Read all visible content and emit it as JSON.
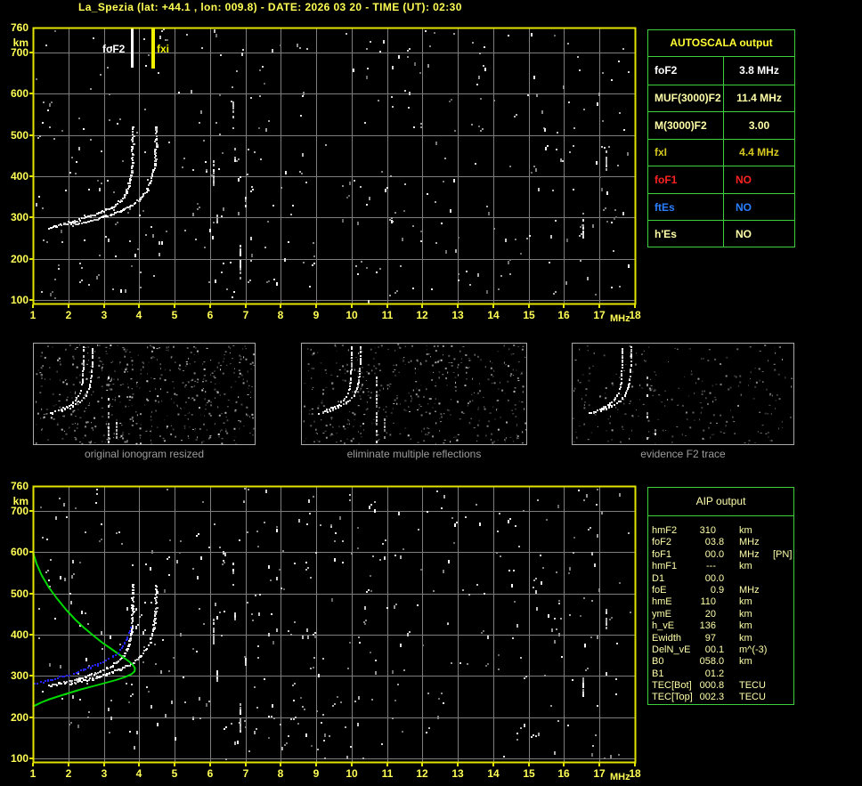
{
  "title": {
    "text": "La_Spezia (lat: +44.1 , lon: 009.8) - DATE: 2026 03 20 - TIME (UT): 02:30"
  },
  "colors": {
    "background": "#000000",
    "frame": "#e3e300",
    "grid": "#7d7d7d",
    "tick_label": "#ffff55",
    "title": "#ffff55",
    "table_border": "#3ecf3e",
    "caption": "#9c9c9c",
    "thumb_border": "#aaaaaa",
    "trace_white": "#ffffff",
    "profile_green": "#00d800",
    "restored_blue": "#2424ff",
    "marker_foF2": "#ffffff",
    "marker_fxi": "#f2f200"
  },
  "axis": {
    "x_labels": [
      "1",
      "2",
      "3",
      "4",
      "5",
      "6",
      "7",
      "8",
      "9",
      "10",
      "11",
      "12",
      "13",
      "14",
      "15",
      "16",
      "17",
      "18"
    ],
    "y_labels": [
      "760",
      "700",
      "600",
      "500",
      "400",
      "300",
      "200",
      "100"
    ],
    "x_unit": "MHz",
    "y_unit": "km"
  },
  "markers": {
    "foF2_label": "foF2",
    "fxi_label": "fxi",
    "foF2_mhz": 3.8,
    "fxi_mhz": 4.4
  },
  "autoscala": {
    "header": "AUTOSCALA output",
    "rows": [
      {
        "label": "foF2",
        "value": "3.8 MHz",
        "color": "#ffffff"
      },
      {
        "label": "MUF(3000)F2",
        "value": "11.4 MHz",
        "color": "#ffffa8"
      },
      {
        "label": "M(3000)F2",
        "value": "3.00",
        "color": "#ffffa8"
      },
      {
        "label": "fxI",
        "value": "4.4 MHz",
        "color": "#d6c81e"
      },
      {
        "label": "foF1",
        "value": "NO",
        "color": "#ff2222"
      },
      {
        "label": "ftEs",
        "value": "NO",
        "color": "#2b7fff"
      },
      {
        "label": "h'Es",
        "value": "NO",
        "color": "#ffffa8"
      }
    ]
  },
  "aip": {
    "header": "AIP output",
    "rows": [
      {
        "label": "hmF2",
        "vi": "310",
        "vf": "",
        "unit": "km",
        "extra": ""
      },
      {
        "label": "foF2",
        "vi": "03",
        "vf": ".8",
        "unit": "MHz",
        "extra": ""
      },
      {
        "label": "foF1",
        "vi": "00",
        "vf": ".0",
        "unit": "MHz",
        "extra": "[PN]"
      },
      {
        "label": "hmF1",
        "vi": "---",
        "vf": "",
        "unit": "km",
        "extra": ""
      },
      {
        "label": "D1",
        "vi": "00",
        "vf": ".0",
        "unit": "",
        "extra": ""
      },
      {
        "label": "foE",
        "vi": "0",
        "vf": ".9",
        "unit": "MHz",
        "extra": ""
      },
      {
        "label": "hmE",
        "vi": "110",
        "vf": "",
        "unit": "km",
        "extra": ""
      },
      {
        "label": "ymE",
        "vi": "20",
        "vf": "",
        "unit": "km",
        "extra": ""
      },
      {
        "label": "h_vE",
        "vi": "136",
        "vf": "",
        "unit": "km",
        "extra": ""
      },
      {
        "label": "Ewidth",
        "vi": "97",
        "vf": "",
        "unit": "km",
        "extra": ""
      },
      {
        "label": "DelN_vE",
        "vi": "00",
        "vf": ".1",
        "unit": "m^(-3)",
        "extra": ""
      },
      {
        "label": "B0",
        "vi": "058",
        "vf": ".0",
        "unit": "km",
        "extra": ""
      },
      {
        "label": "B1",
        "vi": "01",
        "vf": ".2",
        "unit": "",
        "extra": ""
      },
      {
        "label": "TEC[Bot]",
        "vi": "000",
        "vf": ".8",
        "unit": "TECU",
        "extra": ""
      },
      {
        "label": "TEC[Top]",
        "vi": "002",
        "vf": ".3",
        "unit": "TECU",
        "extra": ""
      }
    ]
  },
  "thumbnails": [
    {
      "caption": "original ionogram resized",
      "noise": 540,
      "bright": 215
    },
    {
      "caption": "eliminate multiple reflections",
      "noise": 460,
      "bright": 205
    },
    {
      "caption": "evidence F2 trace",
      "noise": 250,
      "bright": 165
    }
  ],
  "chart_data": [
    {
      "id": "main-ionogram",
      "type": "scatter",
      "title": "scaled ionogram with foF2 and fxI markers",
      "xlabel": "MHz",
      "ylabel": "km",
      "xlim": [
        1,
        18
      ],
      "ylim": [
        100,
        760
      ],
      "grid": true,
      "markers": [
        {
          "name": "foF2",
          "freq_mhz": 3.8,
          "color": "#ffffff"
        },
        {
          "name": "fxi",
          "freq_mhz": 4.4,
          "color": "#f2f200"
        }
      ],
      "series": [
        {
          "name": "O-trace",
          "color": "#ffffff",
          "points": [
            [
              1.42,
              277
            ],
            [
              1.55,
              280
            ],
            [
              1.7,
              283
            ],
            [
              1.85,
              286
            ],
            [
              2.0,
              289
            ],
            [
              2.15,
              292
            ],
            [
              2.3,
              296
            ],
            [
              2.45,
              300
            ],
            [
              2.6,
              304
            ],
            [
              2.75,
              308
            ],
            [
              2.9,
              313
            ],
            [
              3.05,
              319
            ],
            [
              3.2,
              326
            ],
            [
              3.32,
              333
            ],
            [
              3.44,
              342
            ],
            [
              3.54,
              352
            ],
            [
              3.62,
              364
            ],
            [
              3.68,
              377
            ],
            [
              3.72,
              391
            ],
            [
              3.75,
              406
            ],
            [
              3.77,
              424
            ],
            [
              3.785,
              444
            ],
            [
              3.79,
              466
            ],
            [
              3.795,
              490
            ],
            [
              3.8,
              515
            ],
            [
              3.8,
              523
            ]
          ]
        },
        {
          "name": "X-trace",
          "color": "#ffffff",
          "points": [
            [
              2.05,
              283
            ],
            [
              2.25,
              287
            ],
            [
              2.45,
              291
            ],
            [
              2.65,
              295
            ],
            [
              2.85,
              300
            ],
            [
              3.05,
              305
            ],
            [
              3.25,
              311
            ],
            [
              3.45,
              318
            ],
            [
              3.65,
              326
            ],
            [
              3.83,
              335
            ],
            [
              3.98,
              345
            ],
            [
              4.1,
              356
            ],
            [
              4.2,
              369
            ],
            [
              4.28,
              384
            ],
            [
              4.34,
              400
            ],
            [
              4.39,
              418
            ],
            [
              4.42,
              438
            ],
            [
              4.44,
              460
            ],
            [
              4.45,
              484
            ],
            [
              4.455,
              508
            ],
            [
              4.46,
              522
            ]
          ]
        }
      ],
      "noise_streaks": [
        [
          6.66,
          546,
          584
        ],
        [
          6.72,
          440,
          478
        ],
        [
          6.2,
          292,
          318
        ],
        [
          6.86,
          156,
          236
        ],
        [
          7.0,
          330,
          352
        ],
        [
          6.1,
          382,
          440
        ],
        [
          16.55,
          255,
          300
        ],
        [
          17.2,
          420,
          465
        ]
      ],
      "noise_density": 380
    },
    {
      "id": "aip-ionogram",
      "type": "scatter",
      "title": "ionogram with AIP electron density profile and restored F2 trace",
      "xlabel": "MHz",
      "ylabel": "km",
      "xlim": [
        1,
        18
      ],
      "ylim": [
        100,
        760
      ],
      "grid": true,
      "series_from": "main-ionogram",
      "profile": {
        "name": "electron-density-profile",
        "color": "#00d800",
        "points": [
          [
            1.0,
            600
          ],
          [
            1.1,
            572
          ],
          [
            1.25,
            543
          ],
          [
            1.45,
            514
          ],
          [
            1.7,
            485
          ],
          [
            1.95,
            459
          ],
          [
            2.2,
            436
          ],
          [
            2.45,
            416
          ],
          [
            2.7,
            398
          ],
          [
            2.95,
            381
          ],
          [
            3.2,
            366
          ],
          [
            3.45,
            351
          ],
          [
            3.65,
            339
          ],
          [
            3.8,
            329
          ],
          [
            3.88,
            319
          ],
          [
            3.87,
            311
          ],
          [
            3.78,
            304
          ],
          [
            3.6,
            297
          ],
          [
            3.35,
            290
          ],
          [
            3.05,
            283
          ],
          [
            2.7,
            275
          ],
          [
            2.35,
            267
          ],
          [
            2.0,
            258
          ],
          [
            1.7,
            250
          ],
          [
            1.45,
            243
          ],
          [
            1.25,
            236
          ],
          [
            1.1,
            230
          ],
          [
            1.0,
            226
          ]
        ]
      },
      "restored_trace": {
        "name": "restored-F2-trace",
        "color": "#2424ff",
        "points": [
          [
            1.02,
            283
          ],
          [
            1.2,
            287
          ],
          [
            1.4,
            291
          ],
          [
            1.6,
            295
          ],
          [
            1.8,
            300
          ],
          [
            2.0,
            305
          ],
          [
            2.2,
            310
          ],
          [
            2.4,
            316
          ],
          [
            2.6,
            322
          ],
          [
            2.8,
            329
          ],
          [
            2.95,
            335
          ],
          [
            3.1,
            342
          ],
          [
            3.25,
            350
          ],
          [
            3.38,
            359
          ],
          [
            3.48,
            369
          ],
          [
            3.57,
            381
          ],
          [
            3.64,
            394
          ],
          [
            3.69,
            407
          ],
          [
            3.73,
            418
          ]
        ]
      },
      "noise_density": 420
    }
  ]
}
